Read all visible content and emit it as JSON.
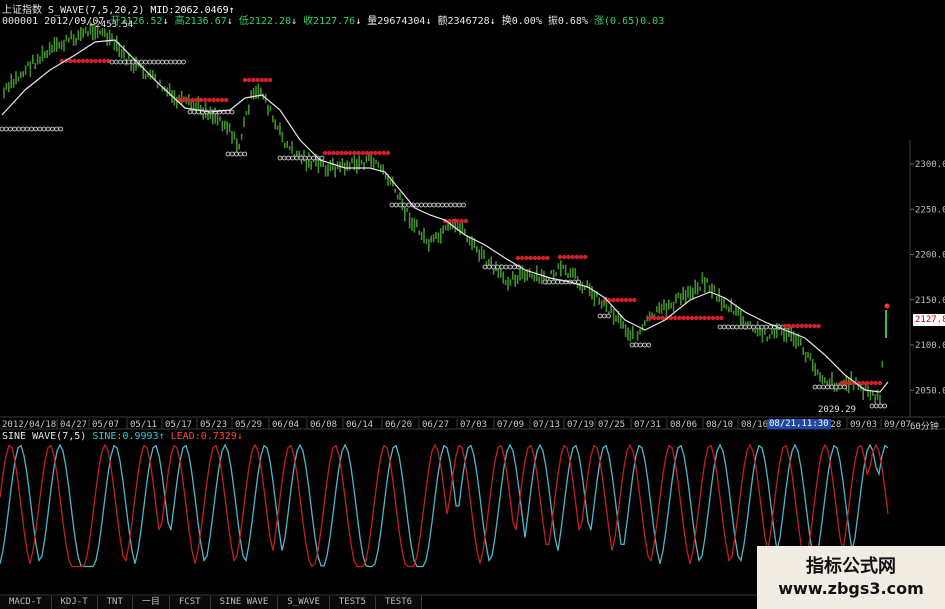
{
  "header": {
    "title": "上证指数",
    "indicator": "S_WAVE(7,5,20,2)",
    "mid_label": "MID:",
    "mid_value": "2062.0469",
    "mid_arrow": "↑",
    "code": "000001",
    "date": "2012/09/07",
    "open": "开2126.52",
    "open_arrow": "↓",
    "high": "高2136.67",
    "high_arrow": "↓",
    "low": "低2122.20",
    "low_arrow": "↓",
    "close": "收2127.76",
    "close_arrow": "↓",
    "volume": "量29674304",
    "volume_arrow": "↓",
    "amount": "额2346728",
    "amount_arrow": "↓",
    "turnover": "换0.00%",
    "amplitude": "振0.68%",
    "change": "涨(0.65)0.03"
  },
  "chart": {
    "max_label": "2453.54",
    "min_label": "2029.29",
    "current_price": "2127.8",
    "y_ticks": [
      "2300.0",
      "2250.0",
      "2200.0",
      "2150.0",
      "2100.0",
      "2050.0"
    ],
    "y_tick_values": [
      2300,
      2250,
      2200,
      2150,
      2100,
      2050
    ],
    "dates": [
      "2012/04/18",
      "04/27",
      "05/07",
      "05/11",
      "05/17",
      "05/23",
      "05/29",
      "06/04",
      "06/08",
      "06/14",
      "06/20",
      "06/27",
      "07/03",
      "07/09",
      "07/13",
      "07/19",
      "07/25",
      "07/31",
      "08/06",
      "08/10",
      "08/16",
      "08/21,11:30",
      "/28",
      "09/03",
      "09/07"
    ],
    "period": "60分钟",
    "cursor_date": "08/21,11:30"
  },
  "sub_chart": {
    "title": "SINE WAVE(7,5)",
    "sine_label": "SINE:",
    "sine_value": "0.9993",
    "sine_arrow": "↑",
    "lead_label": "LEAD:",
    "lead_value": "0.7329",
    "lead_arrow": "↓"
  },
  "tabs": [
    "MACD-T",
    "KDJ-T",
    "TNT",
    "一目",
    "FCST",
    "SINE WAVE",
    "S_WAVE",
    "TEST5",
    "TEST6"
  ],
  "watermark": {
    "title": "指标公式网",
    "url": "www.zbgs3.com"
  },
  "colors": {
    "candle": "#3f8f2a",
    "ma": "#e6e6e6",
    "red_marker": "#d0202a",
    "white_marker": "#d8d8d8",
    "sine": "#4fb6c9",
    "lead": "#c02020"
  }
}
